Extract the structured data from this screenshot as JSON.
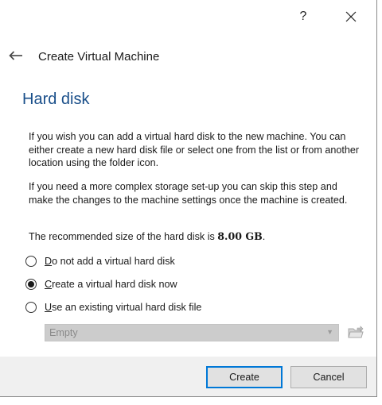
{
  "window": {
    "help_label": "?",
    "close_icon": "close-icon"
  },
  "header": {
    "back_icon": "back-arrow-icon",
    "title": "Create Virtual Machine"
  },
  "page": {
    "title": "Hard disk",
    "paragraph1": "If you wish you can add a virtual hard disk to the new machine. You can either create a new hard disk file or select one from the list or from another location using the folder icon.",
    "paragraph2": "If you need a more complex storage set-up you can skip this step and make the changes to the machine settings once the machine is created.",
    "recommended_prefix": "The recommended size of the hard disk is ",
    "recommended_size": "8.00 GB",
    "recommended_suffix": "."
  },
  "options": [
    {
      "mnemonic": "D",
      "rest": "o not add a virtual hard disk",
      "checked": false
    },
    {
      "mnemonic": "C",
      "rest": "reate a virtual hard disk now",
      "checked": true
    },
    {
      "mnemonic": "U",
      "rest": "se an existing virtual hard disk file",
      "checked": false
    }
  ],
  "existing_disk": {
    "selected_value": "Empty",
    "enabled": false,
    "folder_icon": "folder-icon"
  },
  "footer": {
    "create_label": "Create",
    "cancel_label": "Cancel"
  },
  "colors": {
    "title_blue": "#1a4f8a",
    "footer_bg": "#f0f0f0",
    "default_button_border": "#0078d7"
  }
}
